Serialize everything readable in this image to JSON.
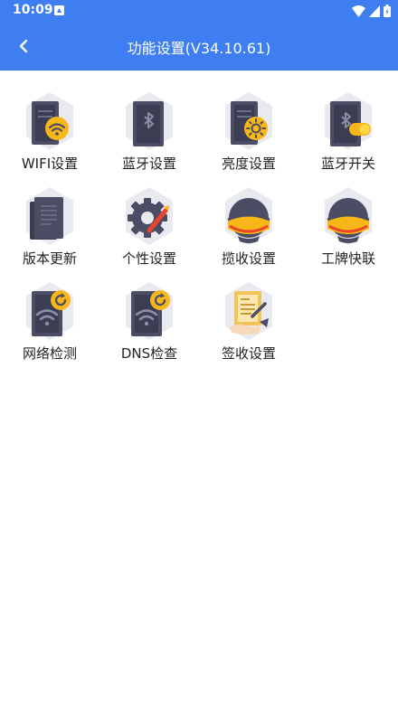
{
  "status_bar": {
    "time": "10:09",
    "icons": [
      "notification-icon",
      "wifi-signal-icon",
      "cell-signal-icon",
      "battery-icon"
    ]
  },
  "header": {
    "title": "功能设置(V34.10.61)",
    "back_icon": "chevron-left-icon"
  },
  "colors": {
    "header_bg": "#3e7ef0",
    "hex_bg": "#e8e8ef",
    "device_dark": "#4a4d63",
    "badge_yellow": "#f7b718",
    "helmet_red": "#e8452c"
  },
  "tiles": [
    {
      "label": "WIFI设置",
      "icon": "wifi-settings-icon"
    },
    {
      "label": "蓝牙设置",
      "icon": "bluetooth-settings-icon"
    },
    {
      "label": "亮度设置",
      "icon": "brightness-settings-icon"
    },
    {
      "label": "蓝牙开关",
      "icon": "bluetooth-toggle-icon"
    },
    {
      "label": "版本更新",
      "icon": "version-update-icon"
    },
    {
      "label": "个性设置",
      "icon": "personalization-icon"
    },
    {
      "label": "揽收设置",
      "icon": "pickup-settings-icon"
    },
    {
      "label": "工牌快联",
      "icon": "badge-quick-link-icon"
    },
    {
      "label": "网络检测",
      "icon": "network-check-icon"
    },
    {
      "label": "DNS检查",
      "icon": "dns-check-icon"
    },
    {
      "label": "签收设置",
      "icon": "signing-settings-icon"
    }
  ]
}
